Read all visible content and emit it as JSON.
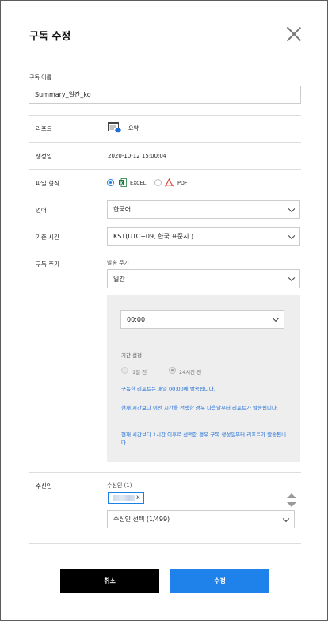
{
  "dialog": {
    "title": "구독 수정"
  },
  "subscription_name": {
    "label": "구독 이름",
    "value": "Summary_일간_ko"
  },
  "report": {
    "label": "리포트",
    "value": "요약"
  },
  "created": {
    "label": "생성일",
    "value": "2020-10-12 15:00:04"
  },
  "file_format": {
    "label": "파일 형식",
    "options": [
      "EXCEL",
      "PDF"
    ],
    "selected": "EXCEL"
  },
  "language": {
    "label": "언어",
    "value": "한국어"
  },
  "timezone": {
    "label": "기준 시간",
    "value": "KST(UTC+09, 한국 표준시 )"
  },
  "cycle": {
    "label": "구독 주기",
    "send_label": "발송 주기",
    "send_value": "일간",
    "time_value": "00:00",
    "period_label": "기간 설정",
    "period_options": [
      "1일 전",
      "24시간 전"
    ],
    "period_selected": "24시간 전",
    "notes": [
      "구독한 리포트는 매일 00:00에 발송됩니다.",
      "현재 시간보다 이전 시간을 선택한 경우 다음날부터 리포트가 발송됩니다.",
      "현재 시간보다 1시간 이후로 선택한 경우 구독 생성일부터 리포트가 발송됩니다."
    ]
  },
  "recipients": {
    "label": "수신인",
    "count_label": "수신인 (1)",
    "remove_icon": "x",
    "select_placeholder": "수신인 선택 (1/499)"
  },
  "buttons": {
    "cancel": "취소",
    "submit": "수정"
  },
  "colors": {
    "accent": "#1f82ea",
    "note_text": "#1f6dd6",
    "cancel_bg": "#000000"
  }
}
